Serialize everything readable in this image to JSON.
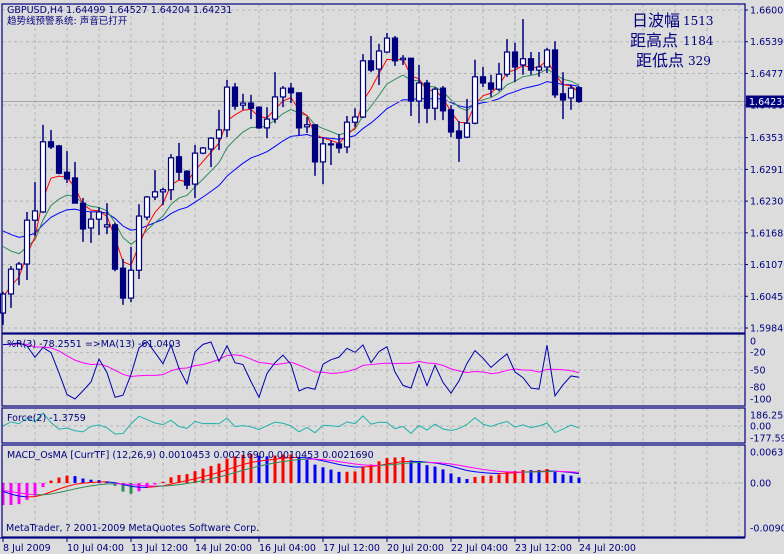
{
  "header": {
    "title": "GBPUSD,H4  1.64499 1.64527 1.64204 1.64231",
    "alert_status": "趋势线预警系统: 声音已打开"
  },
  "stats": [
    {
      "label": "日波幅",
      "value": "1513"
    },
    {
      "label": "距高点",
      "value": "1184"
    },
    {
      "label": "距低点",
      "value": "329"
    }
  ],
  "copyright": "MetaTrader, ? 2001-2009 MetaQuotes Software Corp.",
  "colors": {
    "background": "#dcdcdc",
    "grid": "#b4b4b4",
    "frame": "#00007f",
    "bull_body": "#ffffff",
    "bear_body": "#00007f",
    "ma_fast": "#ff0000",
    "ma_mid": "#2e8b57",
    "ma_slow": "#0000ff",
    "wpr": "#0000b0",
    "wpr_ma": "#ff00ff",
    "force": "#20b2aa",
    "hist_up_rising": "#ff0000",
    "hist_up_falling": "#0000ff",
    "hist_down_falling": "#2e8b57",
    "hist_down_rising": "#ff00ff"
  },
  "chart_data": [
    {
      "type": "candlestick",
      "symbol": "GBPUSD",
      "timeframe": "H4",
      "ylim": [
        1.5984,
        1.66005
      ],
      "y_ticks": [
        "1.66005",
        "1.65390",
        "1.64775",
        "1.64160",
        "1.63530",
        "1.62915",
        "1.62300",
        "1.61685",
        "1.61070",
        "1.60455",
        "1.59840"
      ],
      "last_price": "1.64231",
      "x_tick_labels": [
        "8 Jul 2009",
        "10 Jul 04:00",
        "13 Jul 12:00",
        "14 Jul 20:00",
        "16 Jul 04:00",
        "17 Jul 12:00",
        "20 Jul 20:00",
        "22 Jul 04:00",
        "23 Jul 12:00",
        "24 Jul 20:00"
      ],
      "ohlc": [
        [
          1.6013,
          1.6054,
          1.599,
          1.605
        ],
        [
          1.605,
          1.6104,
          1.6023,
          1.6098
        ],
        [
          1.6098,
          1.6112,
          1.6067,
          1.6108
        ],
        [
          1.6108,
          1.6209,
          1.6077,
          1.6193
        ],
        [
          1.6193,
          1.6267,
          1.6162,
          1.6211
        ],
        [
          1.6209,
          1.6378,
          1.6207,
          1.6345
        ],
        [
          1.6345,
          1.6368,
          1.6331,
          1.6335
        ],
        [
          1.6337,
          1.6339,
          1.6282,
          1.6284
        ],
        [
          1.6286,
          1.6327,
          1.6265,
          1.6273
        ],
        [
          1.6275,
          1.6306,
          1.6226,
          1.6226
        ],
        [
          1.6226,
          1.6236,
          1.6151,
          1.6176
        ],
        [
          1.6178,
          1.6209,
          1.6149,
          1.6195
        ],
        [
          1.6195,
          1.6218,
          1.6164,
          1.6209
        ],
        [
          1.618,
          1.6226,
          1.6166,
          1.6184
        ],
        [
          1.6184,
          1.6188,
          1.6094,
          1.6098
        ],
        [
          1.61,
          1.6118,
          1.6029,
          1.6042
        ],
        [
          1.6042,
          1.6141,
          1.6034,
          1.6096
        ],
        [
          1.6096,
          1.6224,
          1.6079,
          1.6201
        ],
        [
          1.6199,
          1.624,
          1.6193,
          1.6238
        ],
        [
          1.6238,
          1.629,
          1.6232,
          1.6248
        ],
        [
          1.6248,
          1.6256,
          1.6222,
          1.6252
        ],
        [
          1.6252,
          1.6321,
          1.6232,
          1.6314
        ],
        [
          1.6316,
          1.6343,
          1.6271,
          1.6286
        ],
        [
          1.6288,
          1.629,
          1.6253,
          1.6261
        ],
        [
          1.6263,
          1.6339,
          1.6236,
          1.6323
        ],
        [
          1.6323,
          1.6335,
          1.6321,
          1.6333
        ],
        [
          1.6331,
          1.6354,
          1.6296,
          1.6352
        ],
        [
          1.6352,
          1.6407,
          1.6329,
          1.6368
        ],
        [
          1.6368,
          1.6465,
          1.6354,
          1.6451
        ],
        [
          1.6451,
          1.6459,
          1.6407,
          1.6414
        ],
        [
          1.6416,
          1.6438,
          1.6407,
          1.642
        ],
        [
          1.642,
          1.6436,
          1.6389,
          1.641
        ],
        [
          1.6412,
          1.6414,
          1.637,
          1.6372
        ],
        [
          1.6372,
          1.6412,
          1.6352,
          1.6389
        ],
        [
          1.6389,
          1.648,
          1.6381,
          1.6432
        ],
        [
          1.6432,
          1.6453,
          1.6412,
          1.6449
        ],
        [
          1.6449,
          1.6459,
          1.642,
          1.644
        ],
        [
          1.644,
          1.644,
          1.6358,
          1.6372
        ],
        [
          1.6374,
          1.6393,
          1.6362,
          1.6378
        ],
        [
          1.6378,
          1.6378,
          1.6279,
          1.6306
        ],
        [
          1.6306,
          1.6354,
          1.6263,
          1.6341
        ],
        [
          1.6341,
          1.6348,
          1.63,
          1.6341
        ],
        [
          1.6341,
          1.636,
          1.6323,
          1.6333
        ],
        [
          1.6335,
          1.6395,
          1.6323,
          1.6383
        ],
        [
          1.6383,
          1.641,
          1.6374,
          1.6393
        ],
        [
          1.6393,
          1.6515,
          1.6391,
          1.6502
        ],
        [
          1.6502,
          1.655,
          1.648,
          1.6484
        ],
        [
          1.6486,
          1.6535,
          1.6455,
          1.6521
        ],
        [
          1.6519,
          1.6556,
          1.6517,
          1.6546
        ],
        [
          1.6546,
          1.655,
          1.6492,
          1.6502
        ],
        [
          1.6504,
          1.6513,
          1.6494,
          1.6507
        ],
        [
          1.6507,
          1.6507,
          1.6395,
          1.6424
        ],
        [
          1.6424,
          1.6494,
          1.6381,
          1.6459
        ],
        [
          1.6459,
          1.6465,
          1.6381,
          1.641
        ],
        [
          1.641,
          1.6451,
          1.6387,
          1.6447
        ],
        [
          1.6449,
          1.6453,
          1.6387,
          1.6405
        ],
        [
          1.6407,
          1.6416,
          1.6354,
          1.6364
        ],
        [
          1.6366,
          1.6385,
          1.6306,
          1.6352
        ],
        [
          1.6354,
          1.6428,
          1.6352,
          1.6381
        ],
        [
          1.6381,
          1.6504,
          1.6379,
          1.6471
        ],
        [
          1.6471,
          1.649,
          1.6451,
          1.6459
        ],
        [
          1.6459,
          1.6475,
          1.6432,
          1.6447
        ],
        [
          1.6447,
          1.6498,
          1.6443,
          1.6476
        ],
        [
          1.6476,
          1.6544,
          1.6471,
          1.6519
        ],
        [
          1.6519,
          1.6537,
          1.6461,
          1.649
        ],
        [
          1.6494,
          1.6583,
          1.6475,
          1.6506
        ],
        [
          1.6506,
          1.6519,
          1.6475,
          1.6484
        ],
        [
          1.6484,
          1.6519,
          1.6471,
          1.649
        ],
        [
          1.649,
          1.6527,
          1.6478,
          1.6523
        ],
        [
          1.6523,
          1.654,
          1.643,
          1.6436
        ],
        [
          1.6438,
          1.648,
          1.6389,
          1.6426
        ],
        [
          1.643,
          1.6455,
          1.6407,
          1.6449
        ],
        [
          1.64499,
          1.64527,
          1.64204,
          1.64231
        ]
      ]
    },
    {
      "type": "line",
      "indicator": "%R(3)",
      "legend": "%R(3) -78.2551  =>MA(13) -61.0403",
      "ylim": [
        -100,
        0
      ],
      "y_ticks": [
        "0",
        "-20",
        "-50",
        "-80",
        "-100"
      ]
    },
    {
      "type": "line",
      "indicator": "Force(2)",
      "legend": "Force(2) -1.3759",
      "y_ticks": [
        "186.252",
        "0.00",
        "-177.595"
      ]
    },
    {
      "type": "bar",
      "indicator": "MACD_OsMA",
      "legend": "MACD_OsMA [CurrTF] (12,26,9) 0.0010453 0.0021690 0.0010453 0.0021690",
      "ylim": [
        -0.00906,
        0.0063
      ],
      "y_ticks": [
        "0.00630",
        "0.00",
        "-0.00906"
      ]
    }
  ]
}
